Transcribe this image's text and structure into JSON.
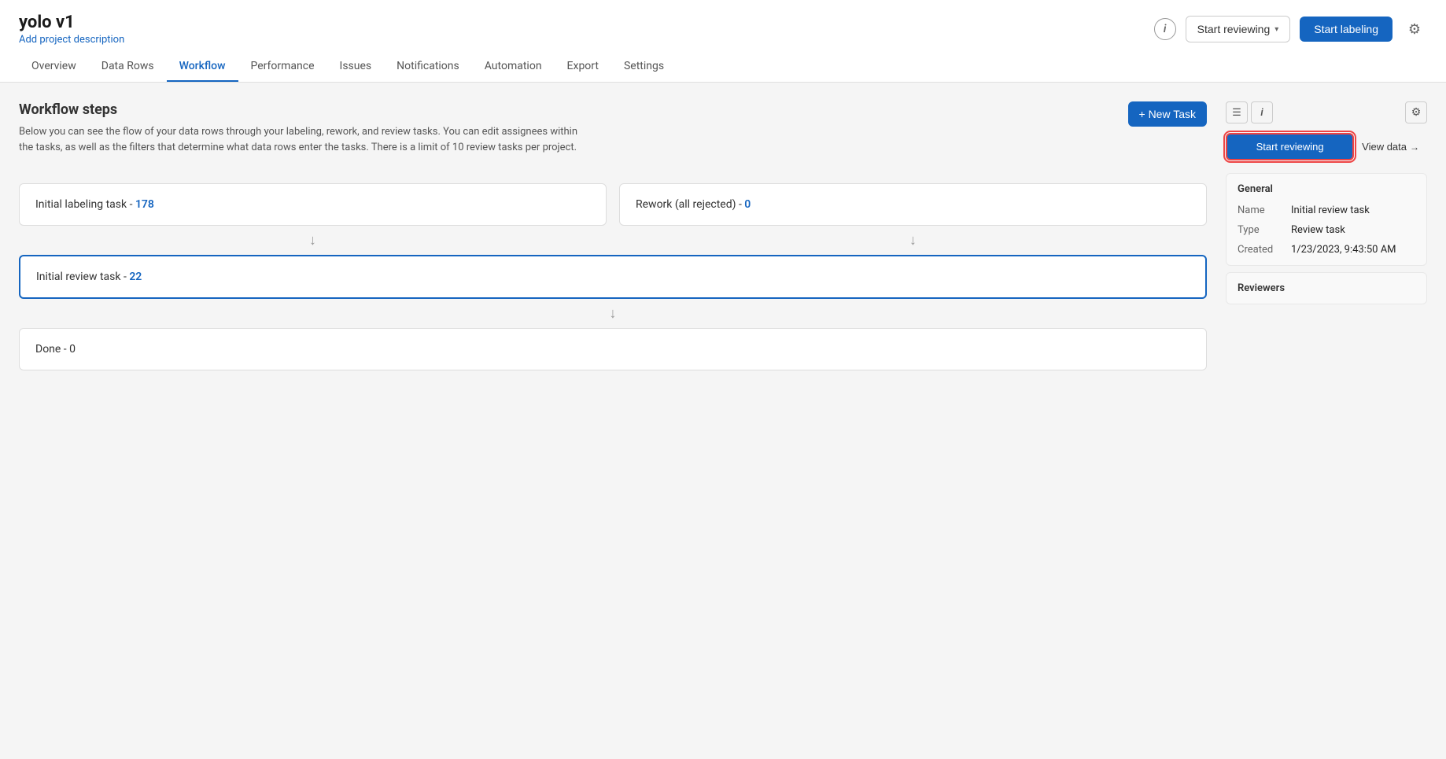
{
  "project": {
    "title": "yolo v1",
    "description": "Add project description"
  },
  "header": {
    "info_icon": "i",
    "start_reviewing_label": "Start reviewing",
    "start_labeling_label": "Start labeling",
    "settings_icon": "⚙"
  },
  "nav": {
    "tabs": [
      {
        "label": "Overview",
        "active": false
      },
      {
        "label": "Data Rows",
        "active": false
      },
      {
        "label": "Workflow",
        "active": true
      },
      {
        "label": "Performance",
        "active": false
      },
      {
        "label": "Issues",
        "active": false
      },
      {
        "label": "Notifications",
        "active": false
      },
      {
        "label": "Automation",
        "active": false
      },
      {
        "label": "Export",
        "active": false
      },
      {
        "label": "Settings",
        "active": false
      }
    ]
  },
  "workflow": {
    "title": "Workflow steps",
    "description": "Below you can see the flow of your data rows through your labeling, rework, and review tasks. You can edit assignees within the tasks, as well as the filters that determine what data rows enter the tasks. There is a limit of 10 review tasks per project.",
    "new_task_label": "+ New Task",
    "tasks": {
      "labeling": {
        "label": "Initial labeling task - ",
        "count": "178"
      },
      "rework": {
        "label": "Rework (all rejected) - ",
        "count": "0"
      },
      "review": {
        "label": "Initial review task - ",
        "count": "22"
      },
      "done": {
        "label": "Done - ",
        "count": "0"
      }
    }
  },
  "panel": {
    "list_icon": "☰",
    "info_icon": "ⓘ",
    "settings_icon": "⚙",
    "start_reviewing_label": "Start reviewing",
    "view_data_label": "View data",
    "arrow_right": "→",
    "general_section_title": "General",
    "fields": {
      "name_label": "Name",
      "name_value": "Initial review task",
      "type_label": "Type",
      "type_value": "Review task",
      "created_label": "Created",
      "created_value": "1/23/2023, 9:43:50 AM"
    },
    "reviewers_label": "Reviewers"
  }
}
